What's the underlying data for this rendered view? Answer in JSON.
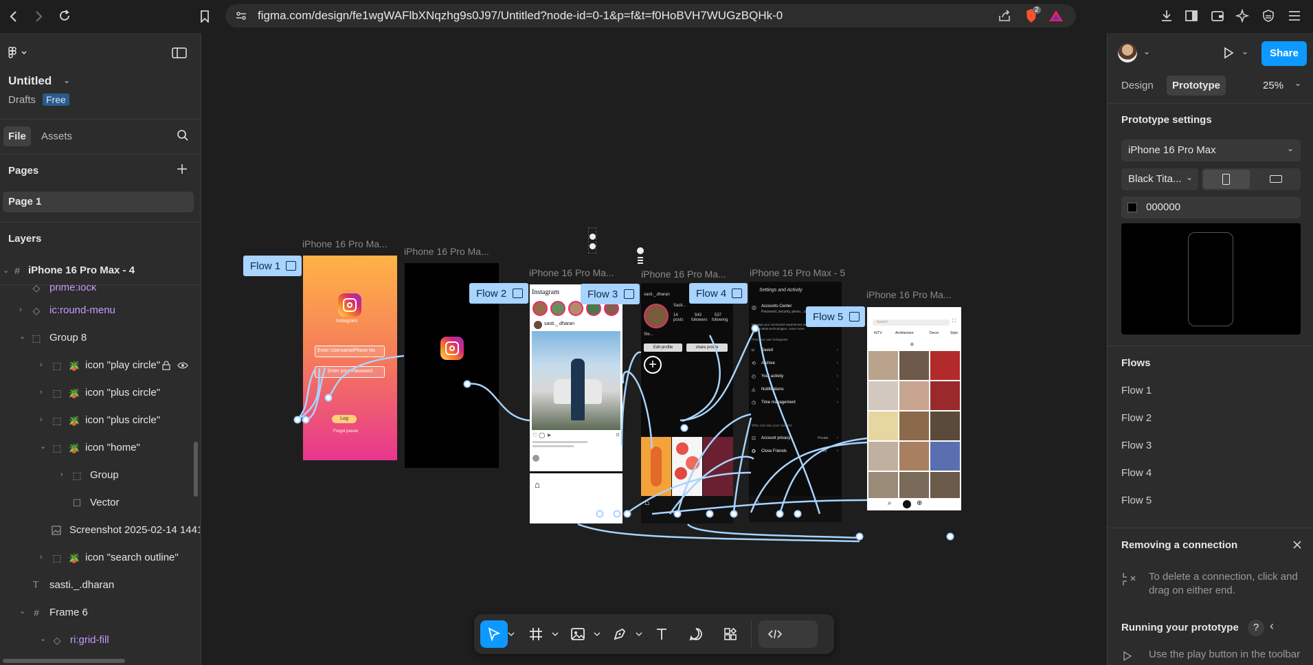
{
  "browser": {
    "url": "figma.com/design/fe1wgWAFlbXNqzhg9s0J97/Untitled?node-id=0-1&p=f&t=f0HoBVH7WUGzBQHk-0",
    "brave_badge": "2"
  },
  "left_panel": {
    "file_title": "Untitled",
    "drafts_label": "Drafts",
    "plan_badge": "Free",
    "tabs": [
      "File",
      "Assets"
    ],
    "pages_heading": "Pages",
    "pages": [
      "Page 1"
    ],
    "layers_heading": "Layers",
    "layers": [
      {
        "name": "iPhone 16 Pro Max - 4"
      },
      {
        "name": "prime:lock"
      },
      {
        "name": "ic:round-menu"
      },
      {
        "name": "Group 8"
      },
      {
        "name": "icon \"play circle\""
      },
      {
        "name": "icon \"plus circle\""
      },
      {
        "name": "icon \"plus circle\""
      },
      {
        "name": "icon \"home\""
      },
      {
        "name": "Group"
      },
      {
        "name": "Vector"
      },
      {
        "name": "Screenshot 2025-02-14 1441"
      },
      {
        "name": "icon \"search outline\""
      },
      {
        "name": "sasti._.dharan"
      },
      {
        "name": "Frame 6"
      },
      {
        "name": "ri:grid-fill"
      }
    ]
  },
  "canvas": {
    "frame_labels": [
      "iPhone 16 Pro Ma...",
      "iPhone 16 Pro Ma...",
      "iPhone 16 Pro Ma...",
      "iPhone 16 Pro Ma...",
      "iPhone 16 Pro Max - 5",
      "iPhone 16 Pro Ma..."
    ],
    "flows": [
      "Flow 1",
      "Flow 2",
      "Flow 3",
      "Flow 4",
      "Flow 5"
    ],
    "login_screen": {
      "brand": "Instagram",
      "username_placeholder": "Enter Username/Phone No",
      "password_placeholder": "Enter your Password",
      "login_button": "Log",
      "forgot": "Forgot passw"
    },
    "feed_screen": {
      "header": "Instagram",
      "post_user": "sasti._.dharan"
    },
    "profile_screen": {
      "username": "sasti._.dharan",
      "name": "Sasti...",
      "posts": "14",
      "posts_label": "posts",
      "followers": "543",
      "followers_label": "followers",
      "following": "537",
      "following_label": "following",
      "bio": "Sle...",
      "edit_profile": "Edit profile",
      "share_profile": "share profile"
    },
    "settings_screen": {
      "title": "Settings and Activity",
      "accounts_center": "Accounts Center",
      "accounts_sub": "Password, security, perso... preferences",
      "manage": "Manage your connected experiences and account settings across Meta technologies. Learn more",
      "section1": "How you use Instagram",
      "items1": [
        "Saved",
        "Archive",
        "Your activity",
        "Notifications",
        "Time management"
      ],
      "section2": "Who can see your content",
      "account_privacy": "Account privacy",
      "account_privacy_value": "Private",
      "close_friends": "Close Friends",
      "close_friends_value": "26"
    },
    "explore_screen": {
      "search_placeholder": "Search",
      "chips": [
        "IGTV",
        "Architecture",
        "Decor",
        "Style"
      ]
    }
  },
  "right_panel": {
    "share_button": "Share",
    "tabs": [
      "Design",
      "Prototype"
    ],
    "zoom": "25%",
    "prototype_settings_heading": "Prototype settings",
    "device": "iPhone 16 Pro Max",
    "model": "Black Tita...",
    "bg_color": "000000",
    "flows_heading": "Flows",
    "flows": [
      "Flow 1",
      "Flow 2",
      "Flow 3",
      "Flow 4",
      "Flow 5"
    ],
    "removing_heading": "Removing a connection",
    "removing_text": "To delete a connection, click and drag on either end.",
    "running_heading": "Running your prototype",
    "running_text": "Use the play button in the toolbar"
  },
  "colors": {
    "accent": "#0d99ff",
    "flow_tag": "#a8d4ff",
    "connector": "#a8d4ff",
    "component_purple": "#c59bff",
    "panel_bg": "#2c2c2c",
    "canvas_bg": "#1e1e1e"
  }
}
